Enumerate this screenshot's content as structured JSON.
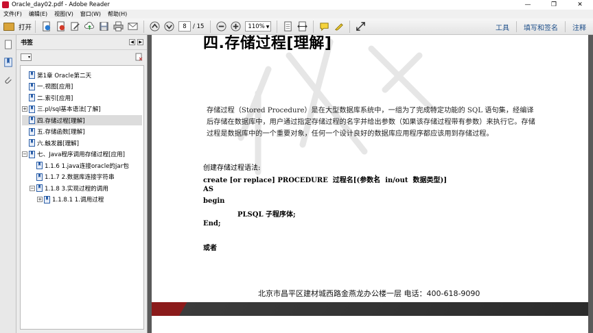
{
  "window": {
    "title": "Oracle_day02.pdf - Adobe Reader",
    "controls": [
      "—",
      "❐",
      "✕"
    ]
  },
  "menu": [
    "文件(F)",
    "编辑(E)",
    "视图(V)",
    "窗口(W)",
    "帮助(H)"
  ],
  "toolbar": {
    "open_label": "打开",
    "page_current": "8",
    "page_total": "/ 15",
    "zoom": "110%",
    "right_links": [
      "工具",
      "填写和签名",
      "注释"
    ]
  },
  "bookmarks": {
    "title": "书签",
    "items": [
      {
        "label": "第1章 Oracle第二天",
        "level": 0,
        "expander": ""
      },
      {
        "label": "一.视图[应用]",
        "level": 0,
        "expander": ""
      },
      {
        "label": "二.索引[应用]",
        "level": 0,
        "expander": ""
      },
      {
        "label": "三.pl/sql基本语法[了解]",
        "level": 0,
        "expander": "+"
      },
      {
        "label": "四.存储过程[理解]",
        "level": 0,
        "expander": "",
        "selected": true
      },
      {
        "label": "五.存储函数[理解]",
        "level": 0,
        "expander": ""
      },
      {
        "label": "六.触发器[理解]",
        "level": 0,
        "expander": ""
      },
      {
        "label": "七、Java程序调用存储过程[应用]",
        "level": 0,
        "expander": "−"
      },
      {
        "label": "1.1.6 1.java连接oracle的jar包",
        "level": 1,
        "expander": ""
      },
      {
        "label": "1.1.7 2.数据库连接字符串",
        "level": 1,
        "expander": ""
      },
      {
        "label": "1.1.8 3.实现过程的调用",
        "level": 1,
        "expander": "−"
      },
      {
        "label": "1.1.8.1 1.调用过程",
        "level": 2,
        "expander": "+"
      }
    ]
  },
  "document": {
    "heading": "四.存储过程[理解]",
    "para1": "存储过程（Stored Procedure）是在大型数据库系统中，一组为了完成特定功能的 SQL 语句集，经编译后存储在数据库中，用户通过指定存储过程的名字并给出参数（如果该存储过程带有参数）来执行它。存储过程是数据库中的一个重要对象，任何一个设计良好的数据库应用程序都应该用到存储过程。",
    "syntax_label": "创建存储过程语法:",
    "code_line1": "create [or replace] PROCEDURE  过程名[(参数名  in/out  数据类型)]",
    "code_line2": "AS",
    "code_line3": "begin",
    "code_line4": "PLSQL 子程序体;",
    "code_line5": "End;",
    "or_label": "或者",
    "footer": "北京市昌平区建材城西路金燕龙办公楼一层      电话：400-618-9090"
  },
  "colors": {
    "accent_link": "#1e4f8a",
    "band_red": "#8b1b1b"
  }
}
